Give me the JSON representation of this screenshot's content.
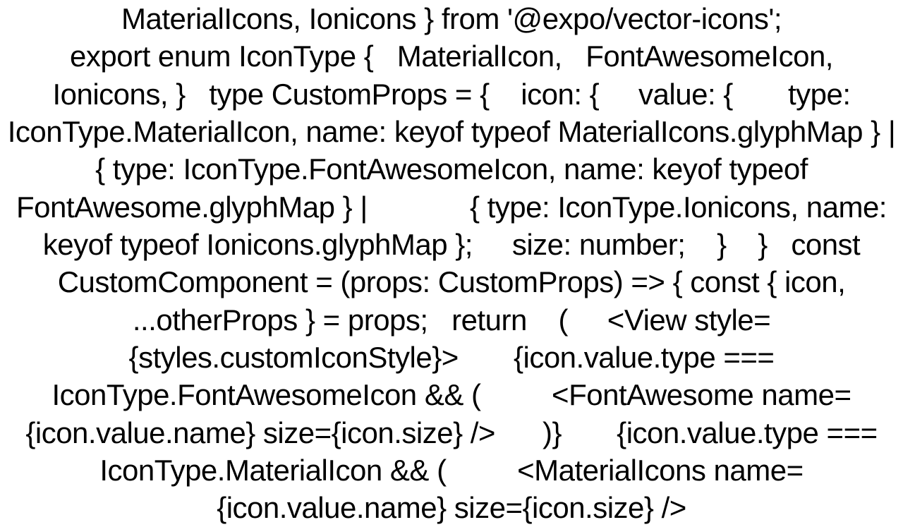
{
  "code_text": "MaterialIcons, Ionicons } from '@expo/vector-icons';\nexport enum IconType {   MaterialIcon,   FontAwesomeIcon,   Ionicons, }   type CustomProps = {    icon: {     value: {       type: IconType.MaterialIcon, name: keyof typeof MaterialIcons.glyphMap } |             { type: IconType.FontAwesomeIcon, name: keyof typeof FontAwesome.glyphMap } |             { type: IconType.Ionicons, name: keyof typeof Ionicons.glyphMap };     size: number;    }    }   const CustomComponent = (props: CustomProps) => { const { icon, ...otherProps } = props;   return    (     <View style={styles.customIconStyle}>       {icon.value.type === IconType.FontAwesomeIcon && (         <FontAwesome name={icon.value.name} size={icon.size} />      )}       {icon.value.type === IconType.MaterialIcon && (         <MaterialIcons name={icon.value.name} size={icon.size} />"
}
